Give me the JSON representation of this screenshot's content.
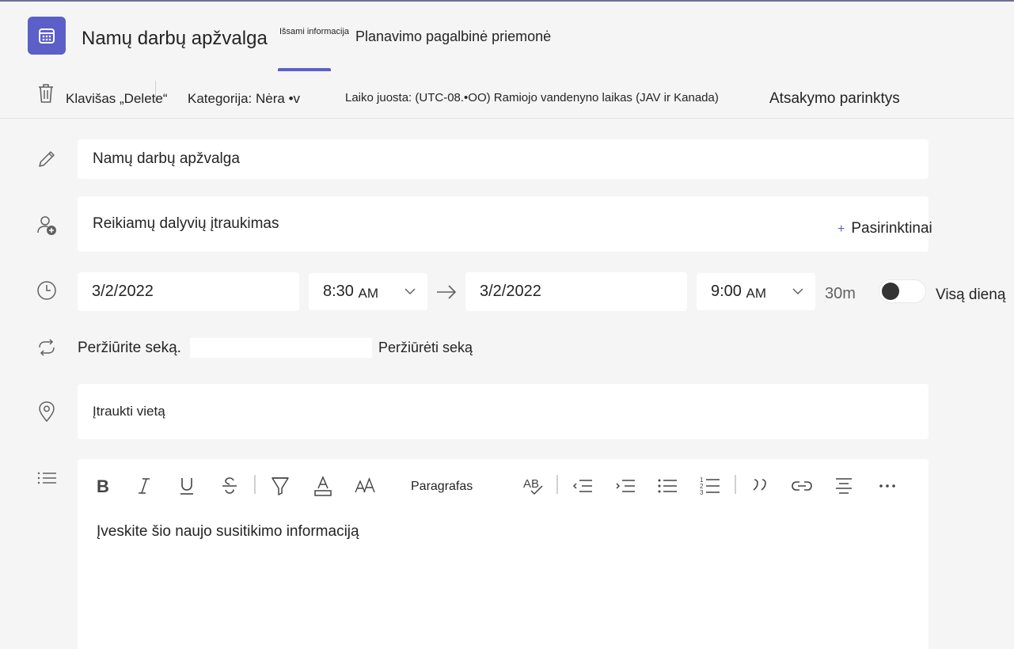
{
  "header": {
    "title": "Namų darbų apžvalga",
    "tab_details": "Išsami informacija",
    "tab_scheduling": "Planavimo pagalbinė priemonė"
  },
  "toolbar": {
    "delete_label": "Klavišas „Delete“",
    "category_label": "Kategorija: Nėra •v",
    "timezone_label": "Laiko juosta: (UTC-08.•OO) Ramiojo vandenyno laikas (JAV ir Kanada)",
    "response_options": "Atsakymo parinktys"
  },
  "form": {
    "title_value": "Namų darbų apžvalga",
    "attendees_placeholder": "Reikiamų dalyvių įtraukimas",
    "optional_label": "Pasirinktinai",
    "start_date": "3/2/2022",
    "start_time": "8:30",
    "start_ampm": "AM",
    "end_date": "3/2/2022",
    "end_time": "9:00",
    "end_ampm": "AM",
    "duration": "30m",
    "all_day_label": "Visą dieną",
    "recurrence_text": "Peržiūrite seką.",
    "recurrence_link": "Peržiūrėti seką",
    "location_placeholder": "Įtraukti vietą",
    "paragraph_label": "Paragrafas",
    "editor_placeholder": "Įveskite šio naujo susitikimo informaciją"
  },
  "colors": {
    "accent": "#5b5fc7",
    "background": "#f5f5f5",
    "field": "#ffffff"
  }
}
